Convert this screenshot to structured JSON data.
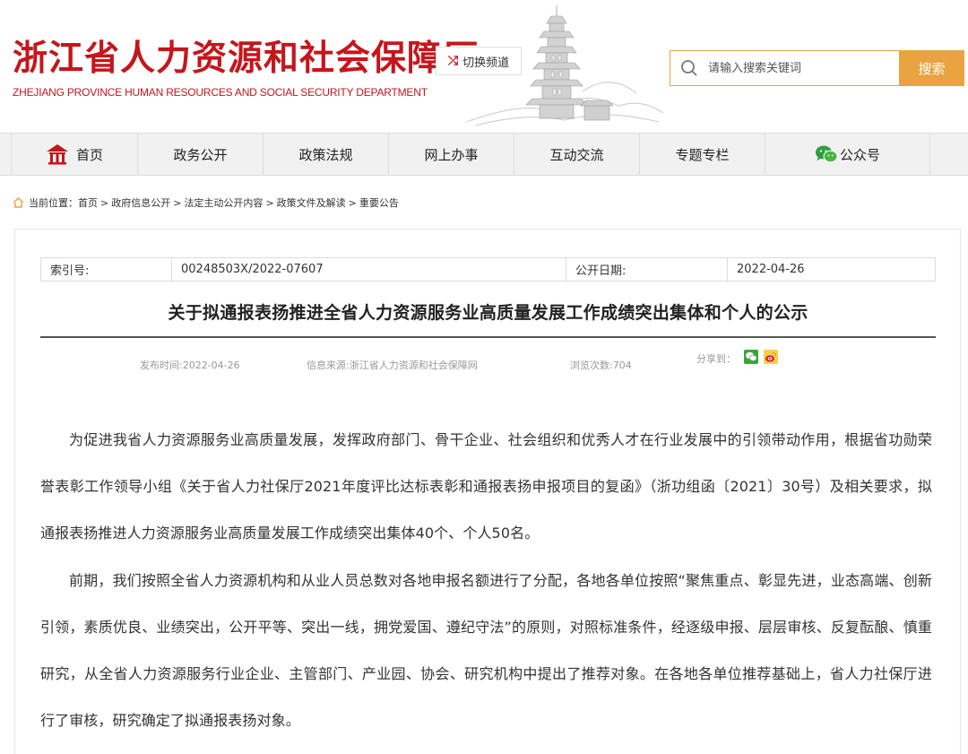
{
  "header": {
    "site_title": "浙江省人力资源和社会保障厅",
    "site_subtitle": "ZHEJIANG PROVINCE HUMAN RESOURCES AND SOCIAL SECURITY DEPARTMENT",
    "switch_label": "切换频道",
    "search_placeholder": "请输入搜索关键词",
    "search_button": "搜索"
  },
  "nav": {
    "items": [
      {
        "label": "首页",
        "icon": "home-icon"
      },
      {
        "label": "政务公开"
      },
      {
        "label": "政策法规"
      },
      {
        "label": "网上办事"
      },
      {
        "label": "互动交流"
      },
      {
        "label": "专题专栏"
      },
      {
        "label": "公众号",
        "icon": "wechat-icon"
      }
    ]
  },
  "breadcrumb": {
    "prefix": "当前位置：",
    "items": [
      "首页",
      "政府信息公开",
      "法定主动公开内容",
      "政策文件及解读",
      "重要公告"
    ],
    "separator": ">"
  },
  "meta": {
    "index_label": "索引号:",
    "index_value": "00248503X/2022-07607",
    "date_label": "公开日期:",
    "date_value": "2022-04-26"
  },
  "article": {
    "title": "关于拟通报表扬推进全省人力资源服务业高质量发展工作成绩突出集体和个人的公示",
    "publish_time": "发布时间:2022-04-26",
    "source": "信息来源:浙江省人力资源和社会保障网",
    "views": "浏览次数:704",
    "share_label": "分享到：",
    "paragraphs": [
      "为促进我省人力资源服务业高质量发展，发挥政府部门、骨干企业、社会组织和优秀人才在行业发展中的引领带动作用，根据省功勋荣誉表彰工作领导小组《关于省人力社保厅2021年度评比达标表彰和通报表扬申报项目的复函》（浙功组函〔2021〕30号）及相关要求，拟通报表扬推进人力资源服务业高质量发展工作成绩突出集体40个、个人50名。",
      "前期，我们按照全省人力资源机构和从业人员总数对各地申报名额进行了分配，各地各单位按照“聚焦重点、彰显先进，业态高端、创新引领，素质优良、业绩突出，公开平等、突出一线，拥党爱国、遵纪守法”的原则，对照标准条件，经逐级申报、层层审核、反复酝酿、慎重研究，从全省人力资源服务行业企业、主管部门、产业园、协会、研究机构中提出了推荐对象。在各地各单位推荐基础上，省人力社保厅进行了审核，研究确定了拟通报表扬对象。"
    ]
  },
  "colors": {
    "brand_red": "#c4161c",
    "search_accent": "#e9a441",
    "nav_bg": "#f1f1f1"
  }
}
